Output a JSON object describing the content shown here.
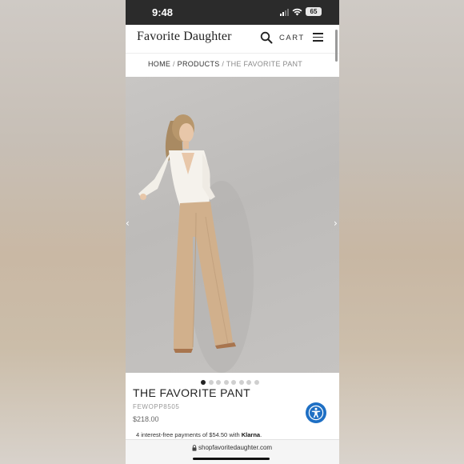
{
  "status_bar": {
    "time": "9:48",
    "battery": "65"
  },
  "header": {
    "logo": "Favorite Daughter",
    "cart_label": "CART"
  },
  "breadcrumb": {
    "home": "HOME",
    "separator": "/",
    "products": "PRODUCTS",
    "current": "THE FAVORITE PANT"
  },
  "gallery": {
    "prev_arrow": "‹",
    "next_arrow": "›",
    "dot_count": 8,
    "active_index": 0
  },
  "product": {
    "title": "THE FAVORITE PANT",
    "sku": "FEWOPP8505",
    "price": "$218.00"
  },
  "klarna": {
    "text": "4 interest-free payments of $54.50 with",
    "brand": "Klarna",
    "suffix": "."
  },
  "browser": {
    "url": "shopfavoritedaughter.com"
  },
  "colors": {
    "accessibility_blue": "#1e6fc4",
    "status_bar": "#2b2b2b",
    "pant_tan": "#d1b08c"
  }
}
